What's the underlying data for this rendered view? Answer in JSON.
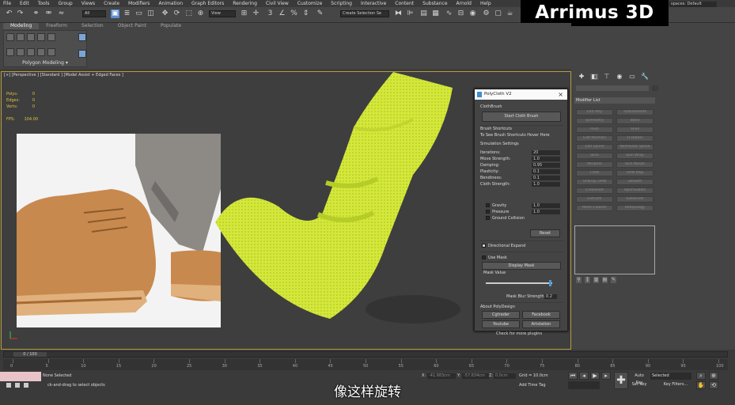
{
  "menu": {
    "items": [
      "File",
      "Edit",
      "Tools",
      "Group",
      "Views",
      "Create",
      "Modifiers",
      "Animation",
      "Graph Editors",
      "Rendering",
      "Civil View",
      "Customize",
      "Scripting",
      "Interactive",
      "Content",
      "Substance",
      "Arnold",
      "Help"
    ]
  },
  "toolbar": {
    "selection_filter": "All",
    "ref_coord": "View",
    "named_selection": "Create Selection Se"
  },
  "brand": {
    "text": "Arrimus 3D"
  },
  "workspace": {
    "label": "spaces:",
    "value": "Default"
  },
  "ribbon": {
    "tabs": [
      "Modeling",
      "Freeform",
      "Selection",
      "Object Paint",
      "Populate"
    ],
    "panel_label": "Polygon Modeling ▾"
  },
  "viewport": {
    "label": "[+] [Perspective ] [Standard ] [Model Assist + Edged Faces ]",
    "stats": [
      {
        "label": "Polys:",
        "value": "0"
      },
      {
        "label": "Edges:",
        "value": "0"
      },
      {
        "label": "Verts:",
        "value": "0"
      }
    ],
    "fps_label": "FPS:",
    "fps_value": "104.00"
  },
  "plugin": {
    "title": "PolyCloth V2",
    "cloth_brush_label": "ClothBrush",
    "start_button": "Start Cloth Brush",
    "shortcuts_label": "Brush Shortcuts",
    "shortcuts_hint": "To See Brush Shortcuts Hover Here",
    "sim_label": "Simulation Settings",
    "params": [
      {
        "label": "Iterations:",
        "value": "20"
      },
      {
        "label": "Move Strength:",
        "value": "1.0"
      },
      {
        "label": "Damping:",
        "value": "0.95"
      },
      {
        "label": "Plasticity:",
        "value": "0.1"
      },
      {
        "label": "Bendiness:",
        "value": "0.1"
      },
      {
        "label": "Cloth Strength:",
        "value": "1.0"
      }
    ],
    "forces": [
      {
        "label": "Gravity",
        "value": "1.0"
      },
      {
        "label": "Pressure",
        "value": "1.0"
      },
      {
        "label": "Ground Collision",
        "value": ""
      }
    ],
    "reset": "Reset",
    "directional": "Directional Expand",
    "use_mask": "Use Mask",
    "display_mask": "Display Mask",
    "mask_value": "Mask Value",
    "mask_value_level": 0.98,
    "blur_label": "Mask Blur Strength:",
    "blur_value": "0.2",
    "about": "About PolyDesign",
    "links": [
      "Cgtrader",
      "Facebook",
      "Youtube",
      "Artstation"
    ],
    "more": "Check for more plugins"
  },
  "command_panel": {
    "modifier_list": "Modifier List",
    "modifiers": [
      "Edit Poly",
      "TurboSmooth",
      "Symmetry",
      "Bend",
      "Push",
      "Shell",
      "Edit Normals",
      "FFD(box)",
      "Edit Spline",
      "Normalize Spline",
      "Slice",
      "Skin Wrap",
      "Morpher",
      "Skin Morph",
      "Cloth",
      "UVW Map",
      "Unwrap UVW",
      "Smooth",
      "CreaseSet",
      "OpenSubdiv",
      "Extrude",
      "Subdivide",
      "Mesh Cleaner",
      "Retopology"
    ]
  },
  "timeline": {
    "frame": "0 / 100",
    "ticks": [
      "0",
      "5",
      "10",
      "15",
      "20",
      "25",
      "30",
      "35",
      "40",
      "45",
      "50",
      "55",
      "60",
      "65",
      "70",
      "75",
      "80",
      "85",
      "90",
      "95",
      "100"
    ]
  },
  "status": {
    "selection": "None Selected",
    "hint": "ck-and-drag to select objects",
    "x_label": "X:",
    "x_value": "-41.683cm",
    "y_label": "Y:",
    "y_value": "-57.634cm",
    "z_label": "Z:",
    "z_value": "0.0cm",
    "grid": "Grid = 10.0cm",
    "add_time_tag": "Add Time Tag",
    "auto_key": "Auto Key",
    "selected": "Selected",
    "set_key": "Set Key",
    "key_filters": "Key Filters..."
  },
  "subtitle": "像这样旋转"
}
